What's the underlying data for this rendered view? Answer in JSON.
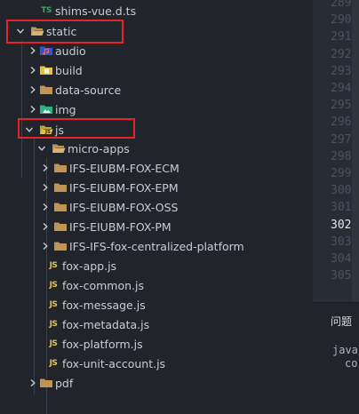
{
  "explorer": {
    "items": [
      {
        "label": "shims-vue.d.ts",
        "icon": "typescript-file-icon",
        "badge": "TS"
      },
      {
        "label": "static",
        "icon": "folder-open-icon"
      },
      {
        "label": "audio",
        "icon": "audio-folder-icon"
      },
      {
        "label": "build",
        "icon": "build-folder-icon"
      },
      {
        "label": "data-source",
        "icon": "folder-icon"
      },
      {
        "label": "img",
        "icon": "image-folder-icon"
      },
      {
        "label": "js",
        "icon": "js-folder-open-icon"
      },
      {
        "label": "micro-apps",
        "icon": "folder-open-icon"
      },
      {
        "label": "IFS-EIUBM-FOX-ECM",
        "icon": "folder-icon"
      },
      {
        "label": "IFS-EIUBM-FOX-EPM",
        "icon": "folder-icon"
      },
      {
        "label": "IFS-EIUBM-FOX-OSS",
        "icon": "folder-icon"
      },
      {
        "label": "IFS-EIUBM-FOX-PM",
        "icon": "folder-icon"
      },
      {
        "label": "IFS-IFS-fox-centralized-platform",
        "icon": "folder-icon"
      },
      {
        "label": "fox-app.js",
        "icon": "javascript-file-icon",
        "badge": "JS"
      },
      {
        "label": "fox-common.js",
        "icon": "javascript-file-icon",
        "badge": "JS"
      },
      {
        "label": "fox-message.js",
        "icon": "javascript-file-icon",
        "badge": "JS"
      },
      {
        "label": "fox-metadata.js",
        "icon": "javascript-file-icon",
        "badge": "JS"
      },
      {
        "label": "fox-platform.js",
        "icon": "javascript-file-icon",
        "badge": "JS"
      },
      {
        "label": "fox-unit-account.js",
        "icon": "javascript-file-icon",
        "badge": "JS"
      },
      {
        "label": "pdf",
        "icon": "folder-icon"
      }
    ]
  },
  "gutter": {
    "lines": [
      "289",
      "290",
      "291",
      "292",
      "293",
      "294",
      "295",
      "296",
      "297",
      "298",
      "299",
      "300",
      "301",
      "302",
      "303",
      "304",
      "305"
    ],
    "active_line": "302"
  },
  "panel": {
    "tab_label": "问题",
    "line1": "java",
    "line2": "co"
  },
  "colors": {
    "highlight_box": "#e5232b",
    "folder": "#c09553",
    "typescript": "#3ea16a",
    "javascript": "#e8c33a"
  }
}
